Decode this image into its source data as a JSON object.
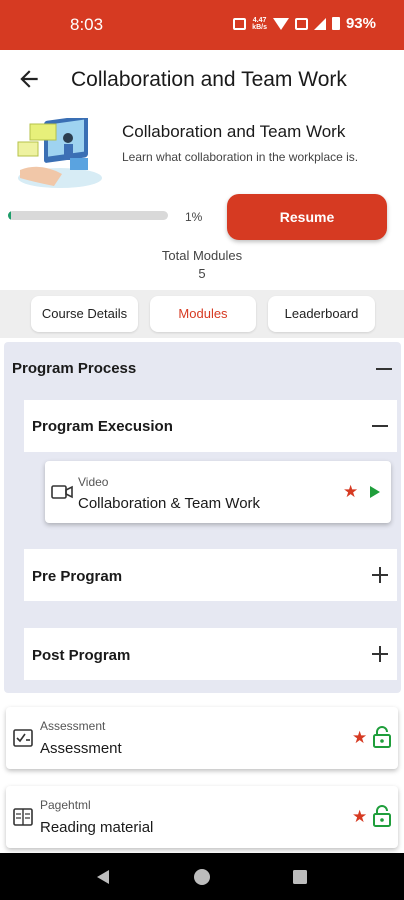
{
  "status_bar": {
    "time": "8:03",
    "network_speed_value": "4.47",
    "network_speed_unit": "kB/s",
    "battery": "93%",
    "color": "#d63a22"
  },
  "header": {
    "title": "Collaboration and Team Work"
  },
  "course": {
    "title": "Collaboration and Team Work",
    "description": "Learn what collaboration in the workplace is.",
    "progress_label": "1%",
    "progress_value": 0.01,
    "resume_label": "Resume",
    "total_modules_label": "Total Modules",
    "total_modules_value": "5"
  },
  "tabs": [
    {
      "label": "Course Details",
      "active": false
    },
    {
      "label": "Modules",
      "active": true
    },
    {
      "label": "Leaderboard",
      "active": false
    }
  ],
  "program": {
    "title": "Program Process",
    "sections": [
      {
        "title": "Program Execusion",
        "expanded": true,
        "items": [
          {
            "type": "Video",
            "name": "Collaboration & Team Work",
            "icon": "video-camera-icon",
            "status": "play"
          }
        ]
      },
      {
        "title": "Pre Program",
        "expanded": false
      },
      {
        "title": "Post Program",
        "expanded": false
      }
    ]
  },
  "modules": [
    {
      "type": "Assessment",
      "name": "Assessment",
      "icon": "assessment-icon",
      "status": "locked"
    },
    {
      "type": "Pagehtml",
      "name": "Reading material",
      "icon": "reading-icon",
      "status": "locked"
    }
  ],
  "colors": {
    "accent": "#d63a22",
    "progress": "#1f9e6b",
    "play": "#1f9e3b",
    "lock": "#1f9e3b",
    "panel": "#e6e8f2"
  }
}
